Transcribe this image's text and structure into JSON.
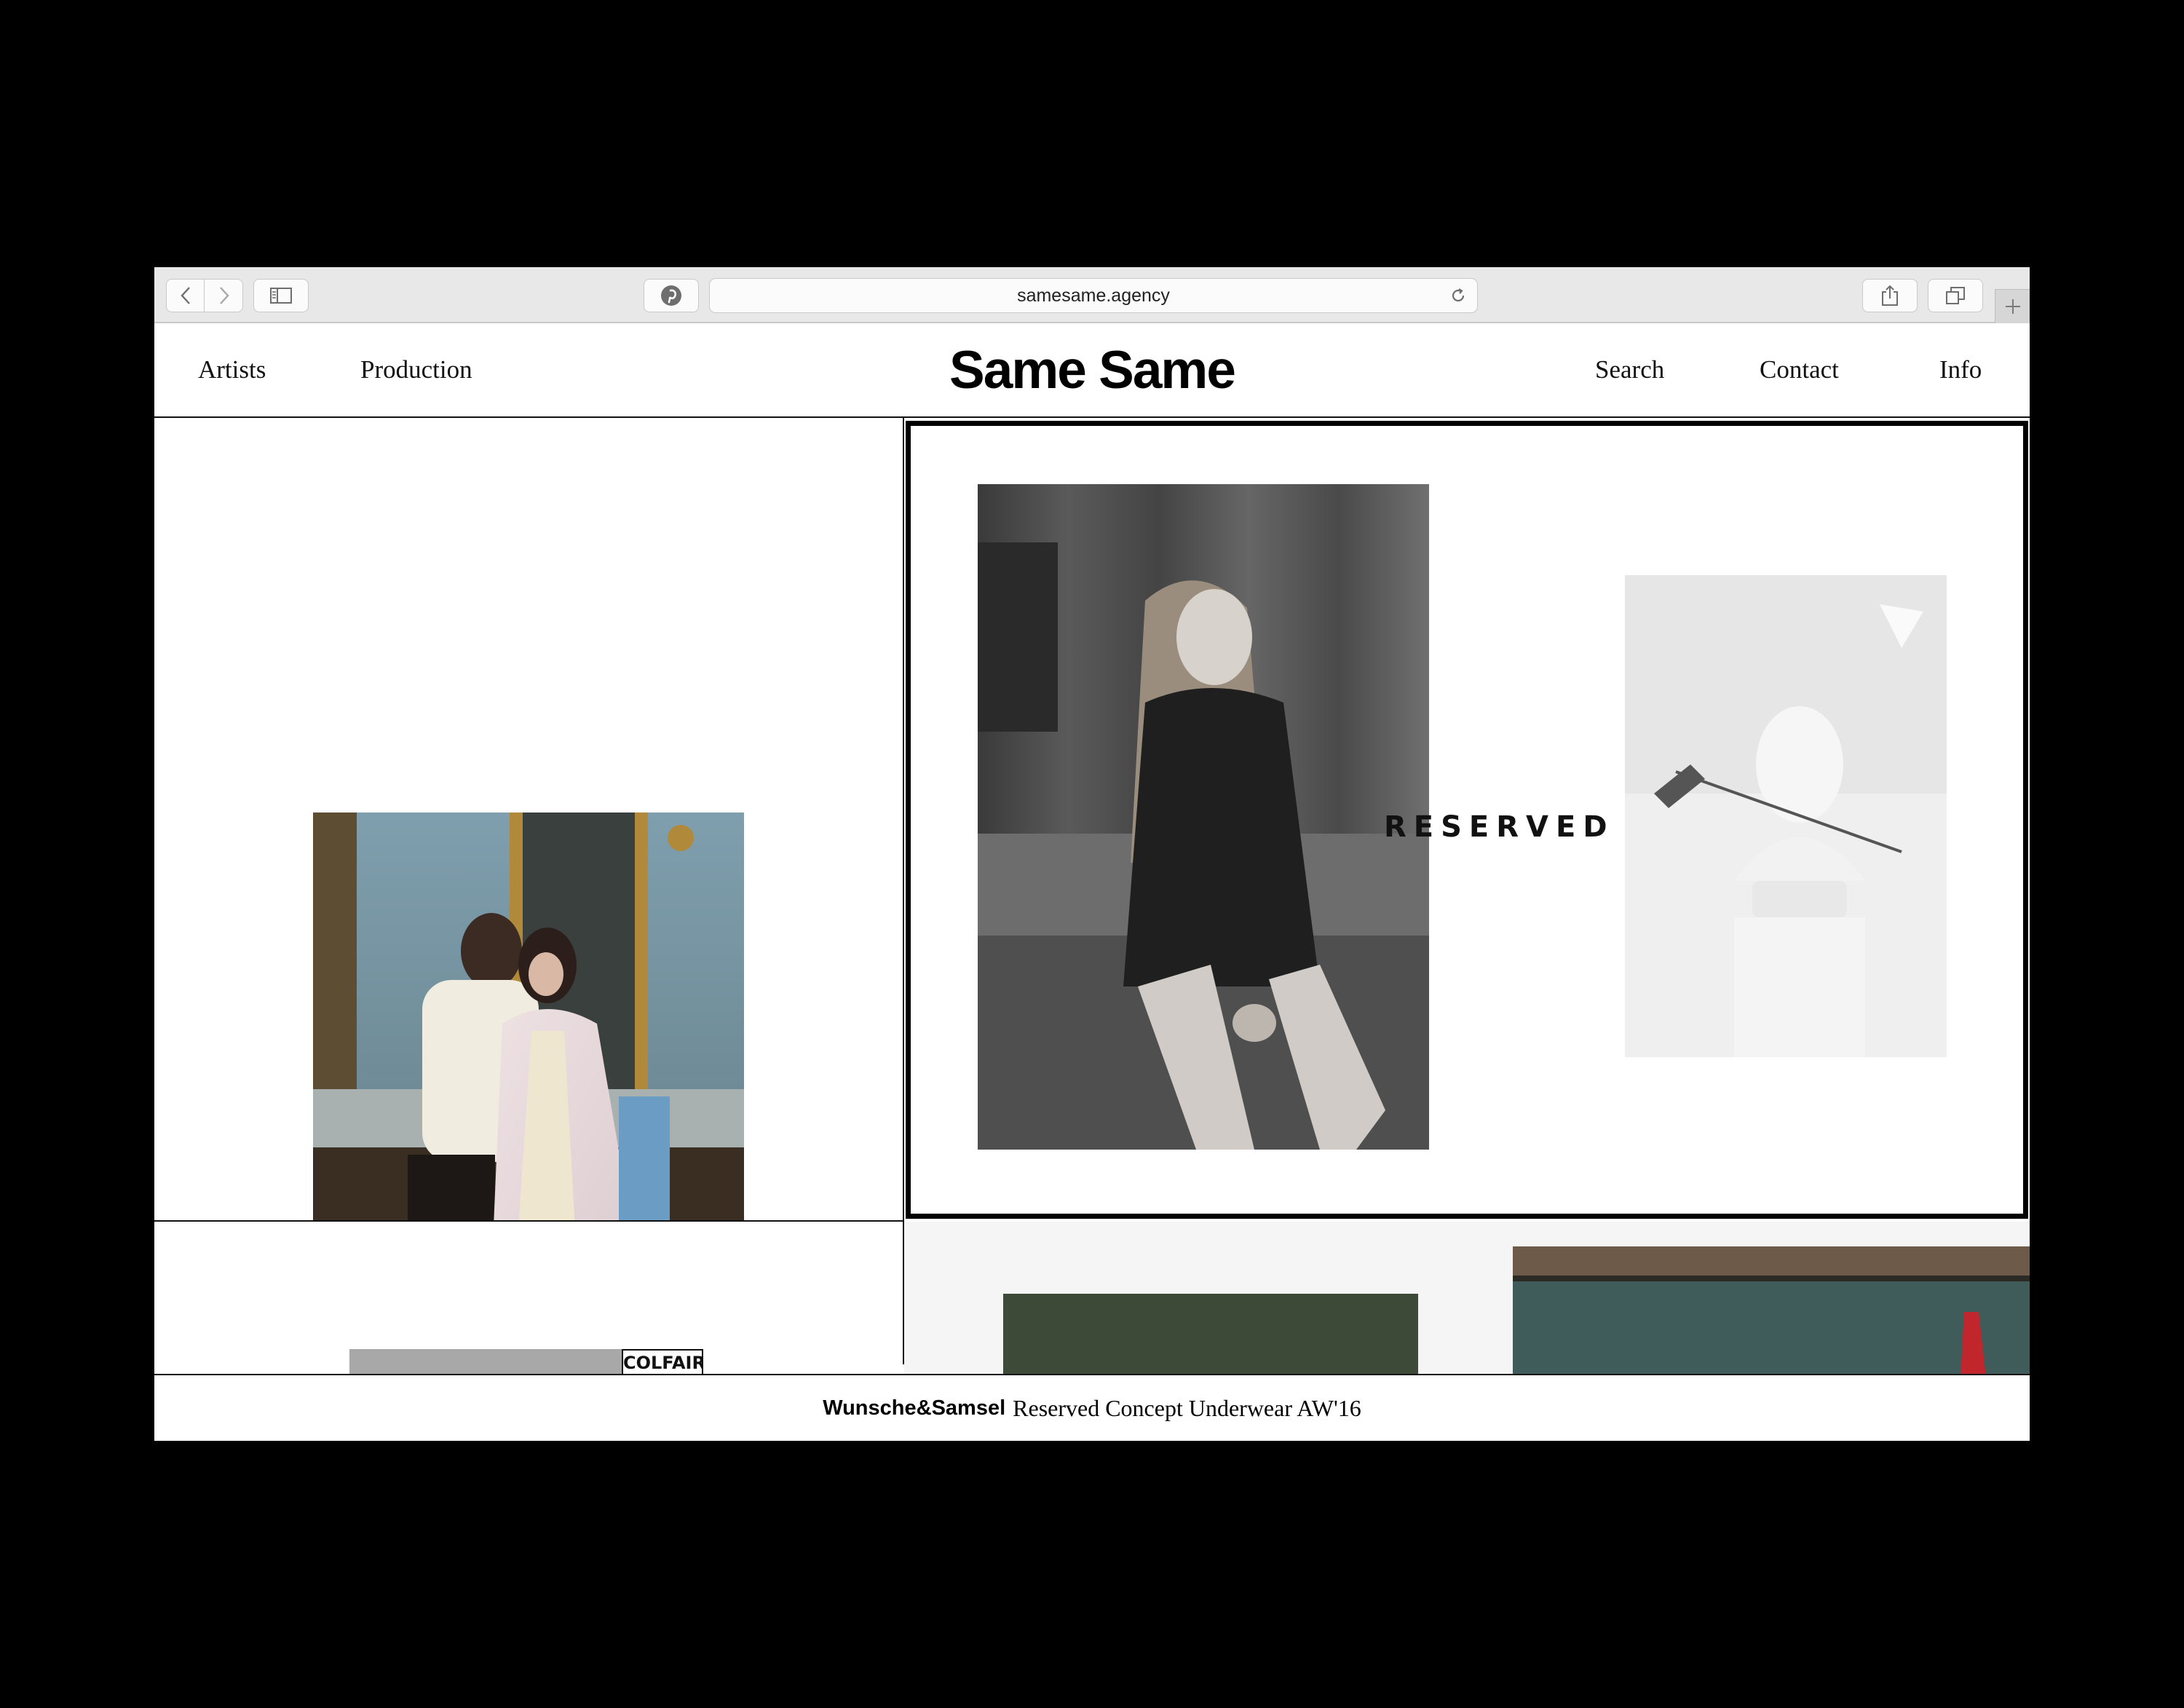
{
  "browser": {
    "url": "samesame.agency"
  },
  "header": {
    "logo": "Same Same",
    "nav_left": [
      "Artists",
      "Production"
    ],
    "nav_right": [
      "Search",
      "Contact",
      "Info"
    ]
  },
  "tiles": {
    "reserved_brand": "RESERVED",
    "colfair_label": "COLFAIR"
  },
  "caption": {
    "artist": "Wunsche&Samsel",
    "project": "Reserved Concept Underwear AW'16"
  },
  "colors": {
    "background": "#000000",
    "toolbar": "#e8e8e8",
    "page": "#ffffff",
    "text": "#111111"
  }
}
